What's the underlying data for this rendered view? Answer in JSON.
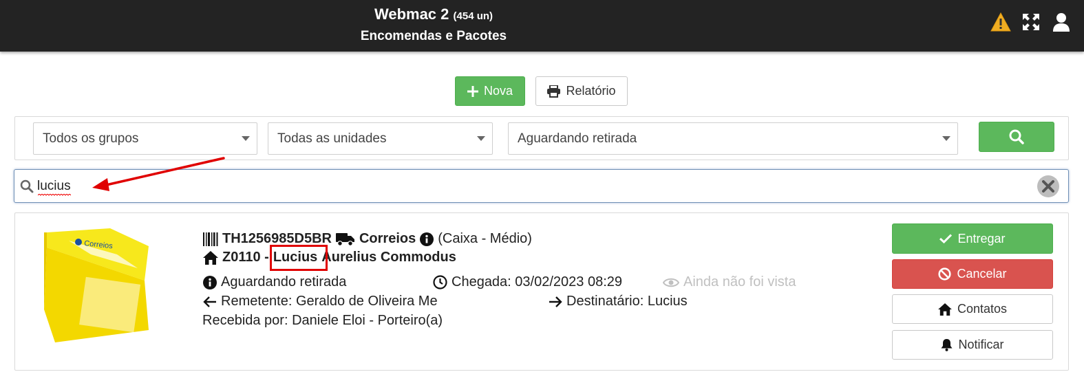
{
  "header": {
    "app_title": "Webmac 2",
    "app_count": "(454 un)",
    "page_title": "Encomendas e Pacotes",
    "icons": [
      "warning-icon",
      "expand-icon",
      "user-icon"
    ]
  },
  "actions": {
    "new_label": "Nova",
    "report_label": "Relatório"
  },
  "filters": {
    "groups": "Todos os grupos",
    "units": "Todas as unidades",
    "status": "Aguardando retirada"
  },
  "search": {
    "value": "lucius"
  },
  "package": {
    "tracking": "TH1256985D5BR",
    "carrier": "Correios",
    "size": "(Caixa - Médio)",
    "unit": "Z0110 -",
    "name_match": "Lucius",
    "name_rest": "Aurelius Commodus",
    "status": "Aguardando retirada",
    "arrival": "Chegada: 03/02/2023 08:29",
    "viewed": "Ainda não foi vista",
    "sender": "Remetente: Geraldo de Oliveira Me",
    "recipient": "Destinatário: Lucius",
    "received_by": "Recebida por: Daniele Eloi - Porteiro(a)",
    "box_brand": "Correios"
  },
  "card_actions": {
    "deliver": "Entregar",
    "cancel": "Cancelar",
    "contacts": "Contatos",
    "notify": "Notificar"
  },
  "colors": {
    "header_bg": "#232323",
    "green": "#5cb85c",
    "red": "#d9534f",
    "highlight": "#e00000"
  }
}
